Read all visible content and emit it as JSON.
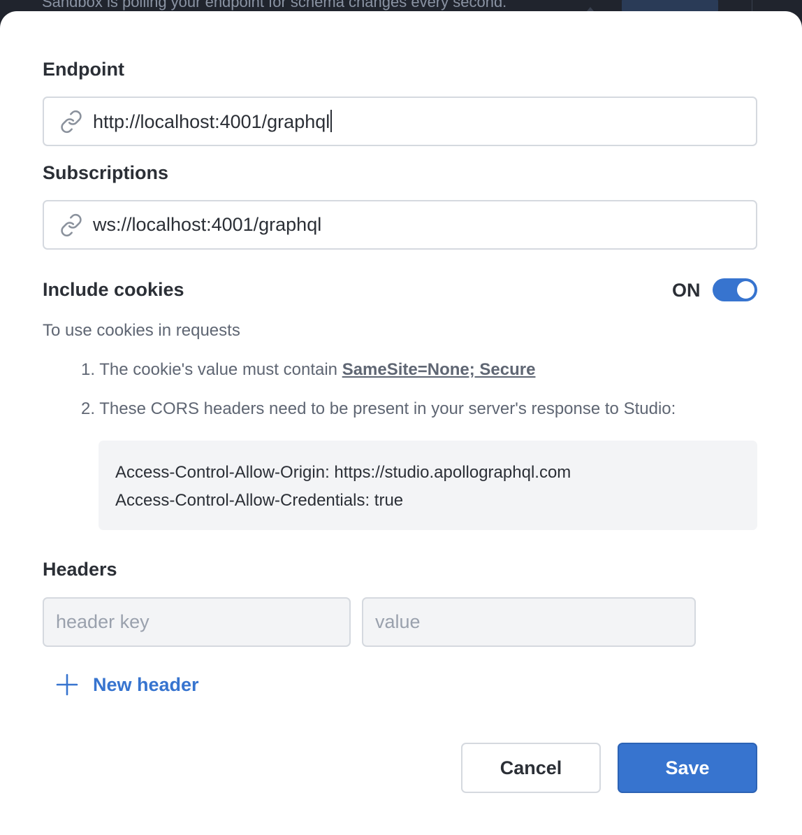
{
  "backdrop": {
    "peek_text": "Sandbox is polling your endpoint for schema changes every second."
  },
  "endpoint": {
    "label": "Endpoint",
    "value": "http://localhost:4001/graphql",
    "icon": "link-icon"
  },
  "subscriptions": {
    "label": "Subscriptions",
    "value": "ws://localhost:4001/graphql",
    "icon": "link-icon"
  },
  "cookies": {
    "label": "Include cookies",
    "toggle_state": "ON",
    "toggle_on": true,
    "description": "To use cookies in requests",
    "step1_prefix": "1. The cookie's value must contain ",
    "step1_emphasis": "SameSite=None; Secure",
    "step2": "2. These CORS headers need to be present in your server's response to Studio:",
    "code_lines": [
      "Access-Control-Allow-Origin: https://studio.apollographql.com",
      "Access-Control-Allow-Credentials: true"
    ]
  },
  "headers": {
    "label": "Headers",
    "key_placeholder": "header key",
    "value_placeholder": "value",
    "new_header_label": "New header",
    "icon": "plus-icon"
  },
  "actions": {
    "cancel_label": "Cancel",
    "save_label": "Save"
  },
  "colors": {
    "accent": "#3774cf",
    "text": "#2b2f36",
    "muted": "#5f6673",
    "border": "#d5d9df",
    "code_bg": "#f3f4f6"
  }
}
